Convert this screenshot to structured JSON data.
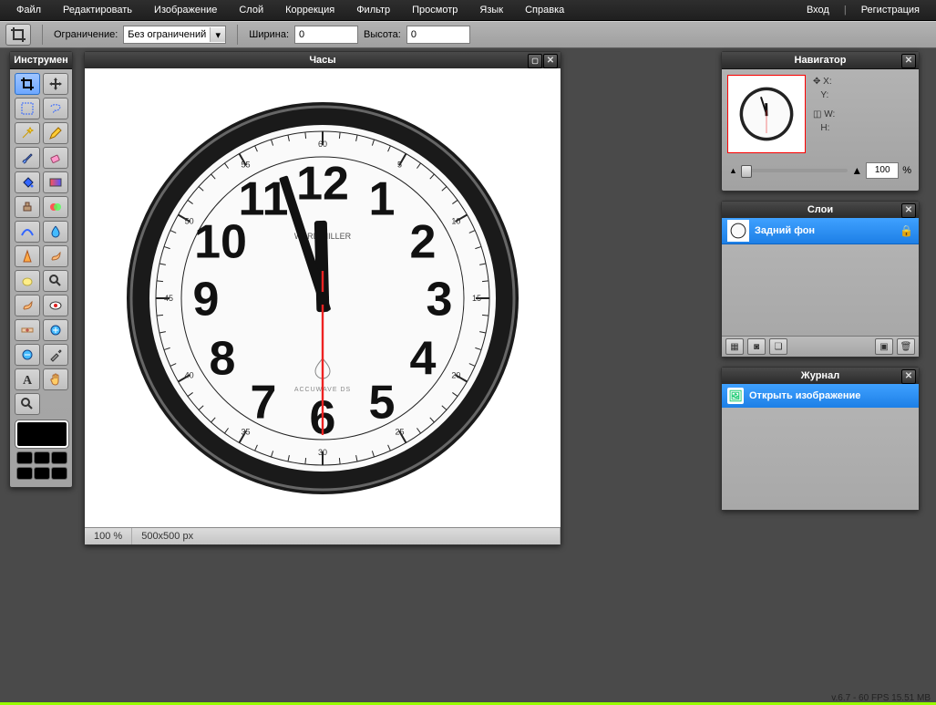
{
  "menu": {
    "file": "Файл",
    "edit": "Редактировать",
    "image": "Изображение",
    "layer": "Слой",
    "adjust": "Коррекция",
    "filter": "Фильтр",
    "view": "Просмотр",
    "lang": "Язык",
    "help": "Справка",
    "login": "Вход",
    "register": "Регистрация",
    "sep": "|"
  },
  "opt": {
    "constraint_label": "Ограничение:",
    "constraint_value": "Без ограничений",
    "width_label": "Ширина:",
    "width_value": "0",
    "height_label": "Высота:",
    "height_value": "0"
  },
  "tools": {
    "title": "Инструмен"
  },
  "doc": {
    "title": "Часы",
    "zoom": "100 %",
    "dims": "500x500 px"
  },
  "nav": {
    "title": "Навигатор",
    "x": "X:",
    "y": "Y:",
    "w": "W:",
    "h": "H:",
    "zoom": "100",
    "pct": "%"
  },
  "layers": {
    "title": "Слои",
    "bg": "Задний фон"
  },
  "history": {
    "title": "Журнал",
    "open": "Открыть изображение"
  },
  "status": {
    "text": "v.6.7 - 60 FPS 15.51 MB"
  },
  "clock": {
    "brand": "WARD MILLER",
    "sub": "ACCUWAVE DS",
    "numbers": [
      "12",
      "1",
      "2",
      "3",
      "4",
      "5",
      "6",
      "7",
      "8",
      "9",
      "10",
      "11"
    ]
  }
}
